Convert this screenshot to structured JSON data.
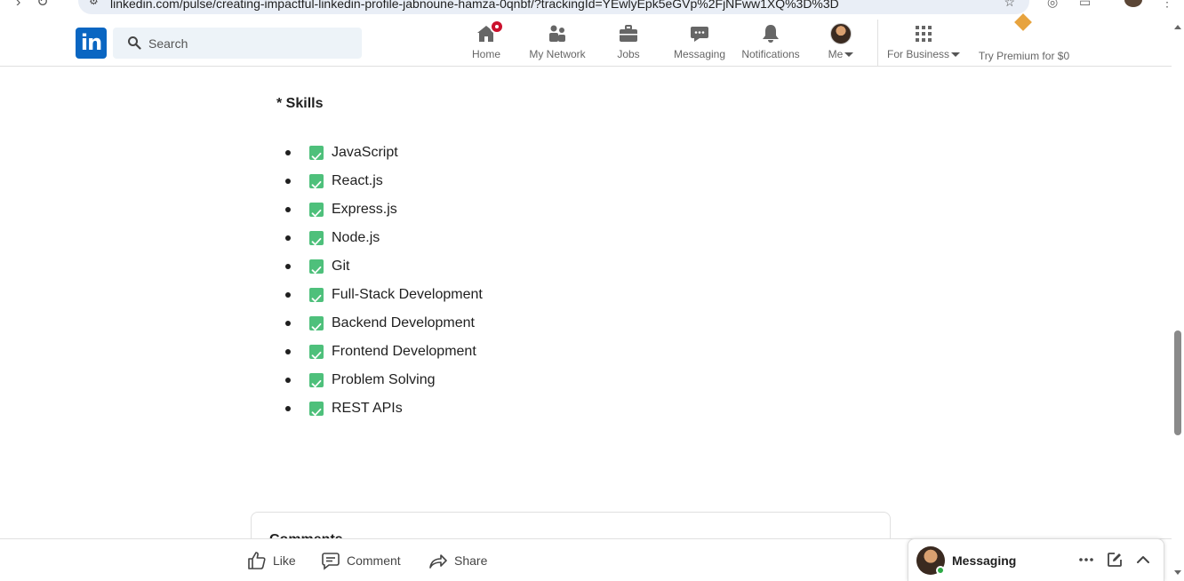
{
  "browser": {
    "url": "linkedin.com/pulse/creating-impactful-linkedin-profile-jabnoune-hamza-0qnbf/?trackingId=YEwlyEpk5eGVp%2FjNFww1XQ%3D%3D"
  },
  "nav": {
    "logo": "in",
    "search_placeholder": "Search",
    "items": [
      {
        "label": "Home",
        "icon": "home-icon"
      },
      {
        "label": "My Network",
        "icon": "network-icon"
      },
      {
        "label": "Jobs",
        "icon": "briefcase-icon"
      },
      {
        "label": "Messaging",
        "icon": "chat-icon"
      },
      {
        "label": "Notifications",
        "icon": "bell-icon"
      },
      {
        "label": "Me",
        "icon": "avatar"
      },
      {
        "label": "For Business",
        "icon": "grid-icon"
      },
      {
        "label": "Try Premium for $0",
        "icon": "premium-icon"
      }
    ]
  },
  "article": {
    "section_heading": "* Skills",
    "skills": [
      "JavaScript",
      "React.js",
      "Express.js",
      "Node.js",
      "Git",
      "Full-Stack Development",
      "Backend Development",
      "Frontend Development",
      "Problem Solving",
      "REST APIs"
    ]
  },
  "comments": {
    "title": "Comments"
  },
  "actions": {
    "like": "Like",
    "comment": "Comment",
    "share": "Share"
  },
  "messaging_widget": {
    "title": "Messaging"
  },
  "colors": {
    "brand": "#0a66c2",
    "badge": "#cb112d",
    "check": "#4ec07b",
    "online": "#2eaa47"
  }
}
